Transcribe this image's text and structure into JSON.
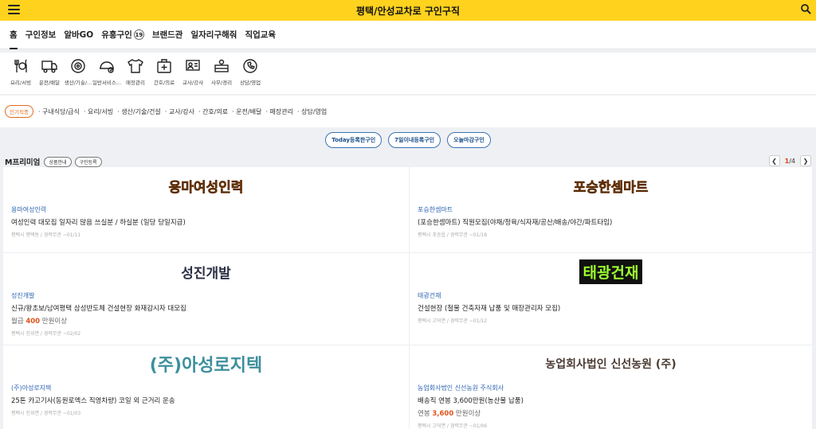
{
  "header": {
    "title": "평택/안성교차로 구인구직"
  },
  "nav": {
    "tabs": [
      {
        "label": "홈"
      },
      {
        "label": "구인정보"
      },
      {
        "label": "알바GO"
      },
      {
        "label": "유흥구인"
      },
      {
        "label": "브랜드관"
      },
      {
        "label": "일자리구해줘"
      },
      {
        "label": "직업교육"
      }
    ],
    "badge": "19"
  },
  "categories": [
    {
      "label": "요리/서빙",
      "icon": "cutlery-icon"
    },
    {
      "label": "운전/배달",
      "icon": "truck-icon"
    },
    {
      "label": "생산/기술/...",
      "icon": "gear-icon"
    },
    {
      "label": "일반서비스...",
      "icon": "service-icon"
    },
    {
      "label": "매장관리",
      "icon": "shirt-icon"
    },
    {
      "label": "간호/의료",
      "icon": "medical-kit-icon"
    },
    {
      "label": "교사/강사",
      "icon": "teacher-icon"
    },
    {
      "label": "사무/경리",
      "icon": "office-icon"
    },
    {
      "label": "상담/영업",
      "icon": "phone-icon"
    }
  ],
  "popular": {
    "pill": "인기직종",
    "keywords": [
      "· 구내식당/급식",
      "· 요리/서빙",
      "· 생산/기술/건설",
      "· 교사/강사",
      "· 간호/의료",
      "· 운전/배달",
      "· 매장관리",
      "· 상담/영업"
    ]
  },
  "quick_buttons": [
    "Today등록한구인",
    "7일이내등록구인",
    "오늘마감구인"
  ],
  "premium": {
    "title": "M프리미엄",
    "tags": [
      "상품안내",
      "구인등록"
    ],
    "pager": {
      "current": "1",
      "total": "/4"
    }
  },
  "cards": [
    {
      "logo": "용마여성인력",
      "logo_color": "#e37e1d",
      "company": "용마여성인력",
      "title": "여성인력 대모집 일자리 많음 쓰실분 / 하실분 (일당 당일지급)",
      "meta": "평택시 평택동 / 경력무관 ~01/11"
    },
    {
      "logo": "포승한셈마트",
      "logo_color": "#e37e1d",
      "company": "포승한셈마트",
      "title": "(포승한셈마트) 직원모집(야채/정육/식자재/공산/배송/야간/파트타임)",
      "meta": "평택시 포승읍 / 경력무관 ~01/18"
    },
    {
      "logo": "성진개발",
      "logo_color": "#2b2f45",
      "company": "성진개발",
      "title": "신규/왕초보/남여평택 삼성반도체 건설현장 화재감시자 대모집",
      "salary_prefix": "월급 ",
      "salary_amount": "400",
      "salary_suffix": " 만원이상",
      "meta": "평택시 진위면 / 경력무관 ~02/02"
    },
    {
      "logo": "태광건재",
      "logo_color": "#9dff2e",
      "company": "태광건재",
      "title": "건설현장 (철물 건축자재 납품 및 매장관리자 모집)",
      "meta": "평택시 고덕면 / 경력무관 ~01/12"
    },
    {
      "logo": "(주)아성로지텍",
      "logo_color": "#3d8f9c",
      "company": "(주)아성로지텍",
      "title": "25톤 카고기사(동원로엑스 직영차량) 코일 외 근거리 운송",
      "meta": "평택시 진위면 / 경력무관 ~01/03"
    },
    {
      "logo": "농업회사법인 신선농원 (주)",
      "logo_color": "#4a3a32",
      "company": "농업회사법인 신선농원 주식회사",
      "title": "배송직 연봉 3,600만원(농산물 납품)",
      "salary_prefix": "연봉 ",
      "salary_amount": "3,600",
      "salary_suffix": " 만원이상",
      "meta": "평택시 고덕면 / 경력무관 ~01/06"
    }
  ],
  "colors": {
    "header_bg": "#ffd21e",
    "accent_orange": "#e06a1b",
    "link_blue": "#2d64b3",
    "quick_border": "#3b72b6"
  }
}
